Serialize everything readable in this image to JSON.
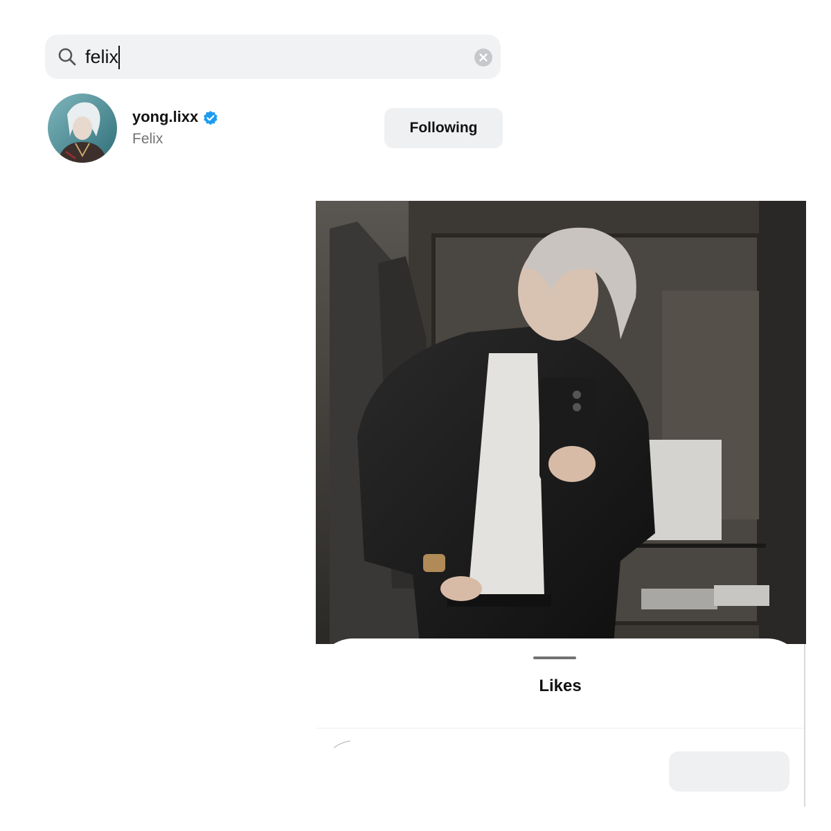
{
  "search": {
    "value": "felix",
    "icon": "search-icon",
    "clear_icon": "clear-icon"
  },
  "result": {
    "username": "yong.lixx",
    "full_name": "Felix",
    "verified": true,
    "badge_icon": "verified-badge-icon",
    "follow_label": "Following",
    "badge_color": "#1d9bf0"
  },
  "likes_sheet": {
    "title": "Likes"
  }
}
